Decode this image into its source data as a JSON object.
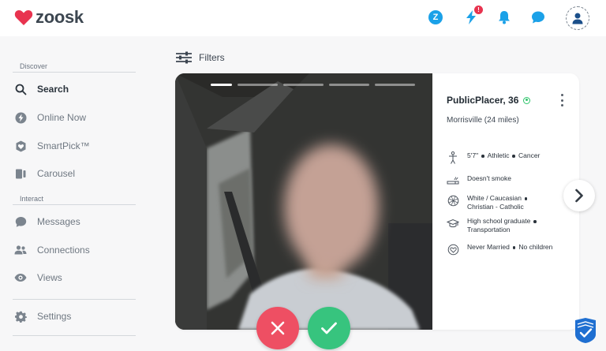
{
  "app": {
    "name": "zoosk",
    "brand_color": "#e8334f",
    "accent_color": "#1ba1e8"
  },
  "header": {
    "z_badge": "Z",
    "notification_count": "!",
    "icons": [
      "zoosk-coin-icon",
      "lightning-icon",
      "bell-icon",
      "chat-bubble-icon",
      "user-avatar-icon"
    ]
  },
  "sidebar": {
    "discover_label": "Discover",
    "interact_label": "Interact",
    "items": [
      {
        "label": "Search",
        "icon": "search-icon",
        "active": true
      },
      {
        "label": "Online Now",
        "icon": "lightning-icon"
      },
      {
        "label": "SmartPick™",
        "icon": "smartpick-icon"
      },
      {
        "label": "Carousel",
        "icon": "carousel-icon"
      },
      {
        "label": "Messages",
        "icon": "chat-bubble-icon"
      },
      {
        "label": "Connections",
        "icon": "people-icon"
      },
      {
        "label": "Views",
        "icon": "eye-icon"
      },
      {
        "label": "Settings",
        "icon": "gear-icon"
      }
    ]
  },
  "filters": {
    "label": "Filters"
  },
  "profile": {
    "name": "PublicPlacer, 36",
    "online": true,
    "location": "Morrisville (24 miles)",
    "photo_count": 5,
    "current_photo": 1,
    "attributes": {
      "height": "5'7\"",
      "body": "Athletic",
      "sign": "Cancer",
      "smoking": "Doesn't smoke",
      "ethnicity": "White / Caucasian",
      "religion": "Christian - Catholic",
      "education": "High school graduate",
      "job": "Transportation",
      "marital": "Never Married",
      "children": "No children"
    }
  },
  "actions": {
    "no": "close-icon",
    "yes": "check-icon",
    "next": "chevron-right-icon"
  }
}
